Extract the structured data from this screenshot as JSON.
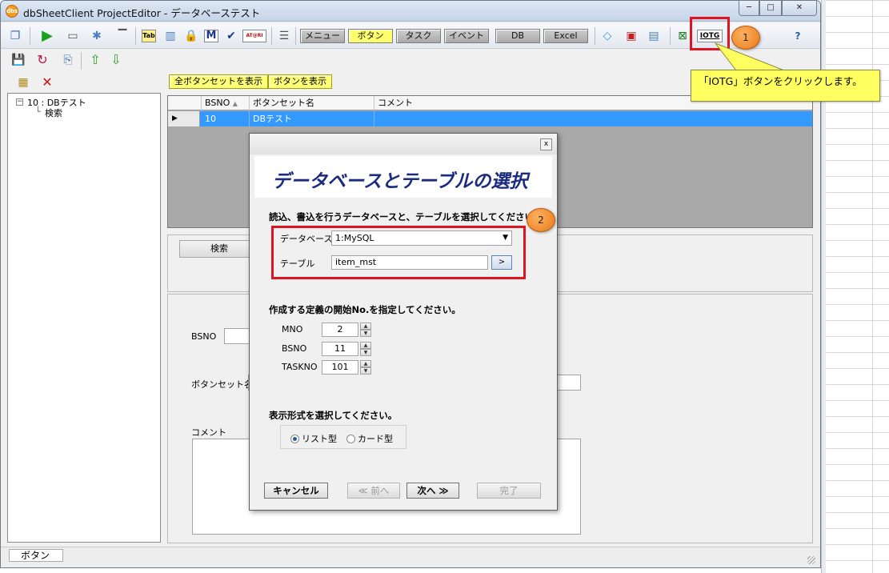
{
  "window": {
    "title": "dbSheetClient ProjectEditor - データベーステスト",
    "app_icon_label": "dbs",
    "controls": {
      "minimize": "─",
      "maximize": "□",
      "close": "✕"
    }
  },
  "toolbar": {
    "tabs": [
      {
        "label": "メニュー",
        "active": false
      },
      {
        "label": "ボタン",
        "active": true
      },
      {
        "label": "タスク",
        "active": false
      },
      {
        "label": "イベント",
        "active": false
      },
      {
        "label": "DB",
        "active": false
      },
      {
        "label": "Excel",
        "active": false
      }
    ],
    "small_buttons": {
      "tab": "Tab",
      "m": "M",
      "atom": "AT@RI",
      "iotg": "IOTG"
    },
    "help": "?"
  },
  "left_panel": {
    "tree_root": "10 : DBテスト",
    "tree_child": "検索"
  },
  "right_panel": {
    "buttons": {
      "show_all_sets": "全ボタンセットを表示",
      "show_buttons": "ボタンを表示"
    },
    "grid": {
      "columns": [
        "BSNO",
        "ボタンセット名",
        "コメント"
      ],
      "rows": [
        {
          "bsno": "10",
          "name": "DBテスト",
          "comment": ""
        }
      ]
    },
    "tab_search": "検索",
    "form": {
      "bsno_label": "BSNO",
      "name_label": "ボタンセット名",
      "comment_label": "コメント"
    }
  },
  "status": {
    "tab": "ボタン"
  },
  "dialog": {
    "heading": "データベースとテーブルの選択",
    "instruction_db": "読込、書込を行うデータベースと、テーブルを選択してください。",
    "db_label": "データベース",
    "db_value": "1:MySQL",
    "table_label": "テーブル",
    "table_value": "item_mst",
    "instruction_no": "作成する定義の開始No.を指定してください。",
    "mno_label": "MNO",
    "mno_value": "2",
    "bsno_label": "BSNO",
    "bsno_value": "11",
    "taskno_label": "TASKNO",
    "taskno_value": "101",
    "instruction_format": "表示形式を選択してください。",
    "radio_list": "リスト型",
    "radio_card": "カード型",
    "btn_cancel": "キャンセル",
    "btn_prev": "≪ 前へ",
    "btn_next": "次へ ≫",
    "btn_finish": "完了"
  },
  "annotations": {
    "callout1": "1",
    "callout2": "2",
    "tooltip": "「IOTG」ボタンをクリックします。",
    "highlight_color": "#e0141e",
    "callout_color": "#e87a18",
    "tooltip_color": "#ffff60"
  }
}
